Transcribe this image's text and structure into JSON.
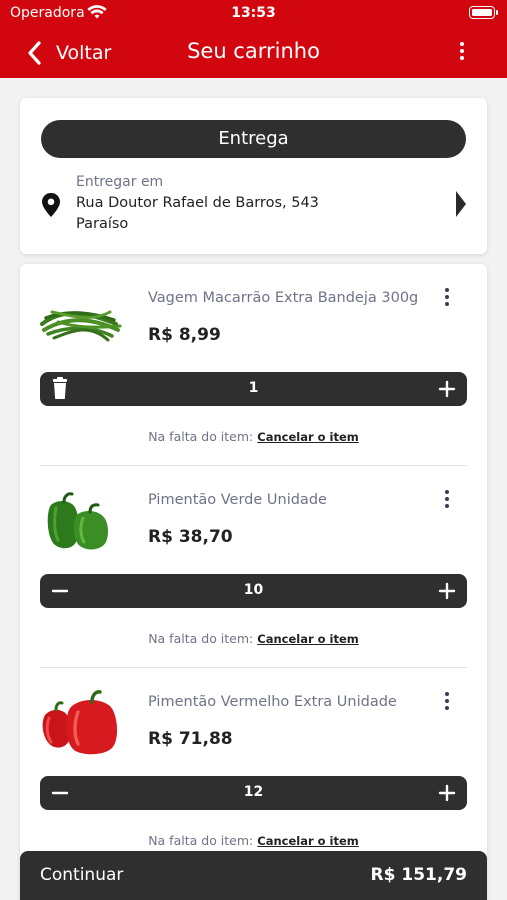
{
  "status_bar": {
    "carrier": "Operadora",
    "time": "13:53"
  },
  "nav": {
    "back_label": "Voltar",
    "title": "Seu carrinho"
  },
  "delivery": {
    "mode": "Entrega",
    "label": "Entregar em",
    "address_line1": "Rua Doutor Rafael de Barros, 543",
    "address_line2": "Paraíso"
  },
  "items": [
    {
      "name": "Vagem Macarrão Extra Bandeja 300g",
      "price": "R$ 8,99",
      "quantity": "1",
      "decrement_icon": "trash-icon",
      "image": "green-beans"
    },
    {
      "name": "Pimentão Verde Unidade",
      "price": "R$ 38,70",
      "quantity": "10",
      "decrement_icon": "minus-icon",
      "image": "green-peppers"
    },
    {
      "name": "Pimentão Vermelho Extra Unidade",
      "price": "R$ 71,88",
      "quantity": "12",
      "decrement_icon": "minus-icon",
      "image": "red-peppers"
    }
  ],
  "shortage": {
    "label": "Na falta do item:",
    "action": "Cancelar o item"
  },
  "footer": {
    "continue_label": "Continuar",
    "total": "R$ 151,79"
  },
  "colors": {
    "brand_red": "#d2060f",
    "dark": "#2f2f2f",
    "muted_text": "#6f7388"
  }
}
